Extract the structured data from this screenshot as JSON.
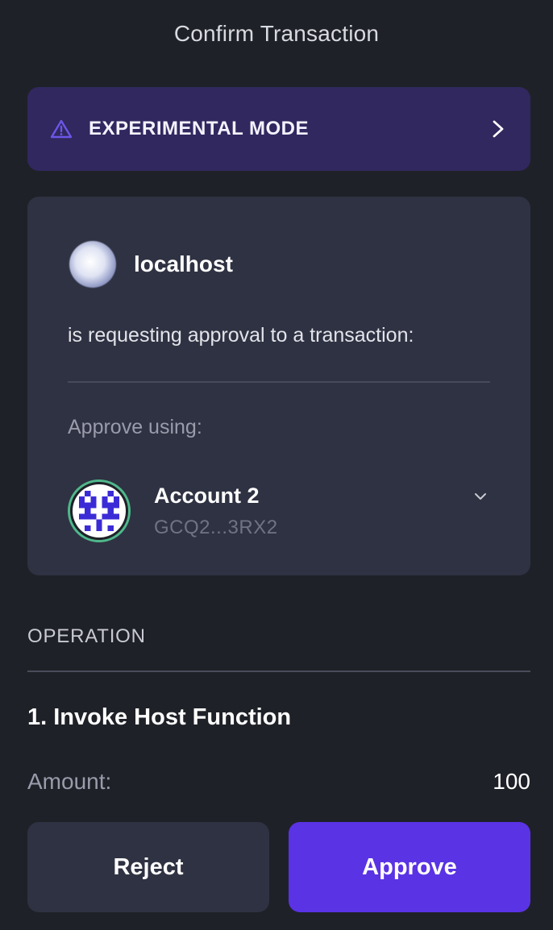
{
  "header": {
    "title": "Confirm Transaction"
  },
  "banner": {
    "label": "EXPERIMENTAL MODE",
    "icon": "warning-triangle-icon",
    "accent": "#6b56e8"
  },
  "request": {
    "site": "localhost",
    "message": "is requesting approval to a transaction:",
    "approve_using_label": "Approve using:"
  },
  "account": {
    "name": "Account 2",
    "address": "GCQ2...3RX2",
    "ring_color": "#4fb88c",
    "identicon_color": "#3b2bd6"
  },
  "operation": {
    "section_label": "OPERATION",
    "title": "1. Invoke Host Function",
    "amount_label": "Amount:",
    "amount_value": "100"
  },
  "actions": {
    "reject_label": "Reject",
    "approve_label": "Approve",
    "approve_color": "#5a33e4"
  }
}
